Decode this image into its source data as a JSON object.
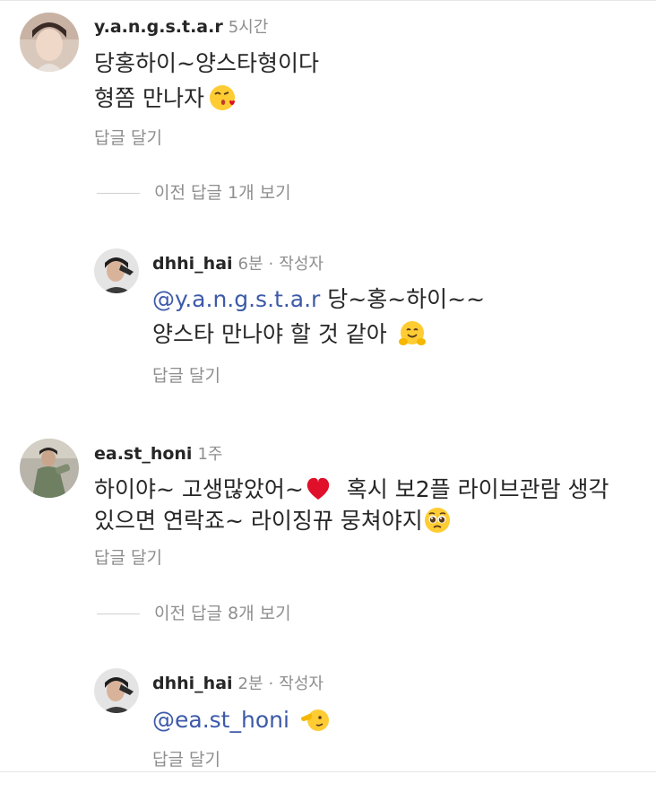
{
  "comments": [
    {
      "username": "y.a.n.g.s.t.a.r",
      "time": "5시간",
      "lines": [
        "당홍하이~양스타형이다",
        "형쫌 만나자"
      ],
      "emoji": "kissing-heart-emoji",
      "reply_label": "답글 달기"
    },
    {
      "username": "ea.st_honi",
      "time": "1주",
      "lines": [
        "하이야~ 고생많았어~",
        "혹시 보2플 라이브관람 생각",
        "있으면 연락죠~ 라이징뀨 뭉쳐야지"
      ],
      "emoji": [
        "red-heart-emoji",
        "pleading-face-emoji"
      ],
      "reply_label": "답글 달기"
    }
  ],
  "view_previous": [
    {
      "label": "이전 답글 1개 보기"
    },
    {
      "label": "이전 답글 8개 보기"
    }
  ],
  "replies": [
    {
      "username": "dhhi_hai",
      "time": "6분",
      "separator": "·",
      "author_badge": "작성자",
      "mention": "@y.a.n.g.s.t.a.r",
      "line1_rest": "당~홍~하이~~",
      "line2": "양스타 만나야 할 것 같아",
      "emoji": "hugging-face-emoji",
      "reply_label": "답글 달기"
    },
    {
      "username": "dhhi_hai",
      "time": "2분",
      "separator": "·",
      "author_badge": "작성자",
      "mention": "@ea.st_honi",
      "emoji": "pointing-face-emoji",
      "reply_label": "답글 달기"
    }
  ],
  "colors": {
    "mention": "#3d5aa8",
    "secondary_text": "#8e8e8e",
    "primary_text": "#262626",
    "heart": "#e0102a",
    "emoji_yellow": "#ffcc33"
  }
}
